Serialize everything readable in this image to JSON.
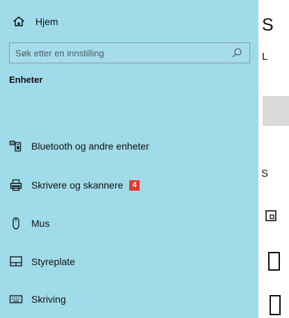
{
  "sidebar": {
    "home_label": "Hjem",
    "search": {
      "placeholder": "Søk etter en innstilling"
    },
    "section_title": "Enheter",
    "items": [
      {
        "label": "Bluetooth og andre enheter",
        "icon": "bluetooth-devices-icon"
      },
      {
        "label": "Skrivere og skannere",
        "icon": "printer-icon",
        "badge": "4"
      },
      {
        "label": "Mus",
        "icon": "mouse-icon"
      },
      {
        "label": "Styreplate",
        "icon": "touchpad-icon"
      },
      {
        "label": "Skriving",
        "icon": "keyboard-icon"
      }
    ]
  },
  "content": {
    "title": "S",
    "first_line": "L",
    "subheading": "S"
  },
  "colors": {
    "sidebar_background": "#9fdbe9",
    "badge": "#e43b2f",
    "content_background": "#ffffff"
  }
}
